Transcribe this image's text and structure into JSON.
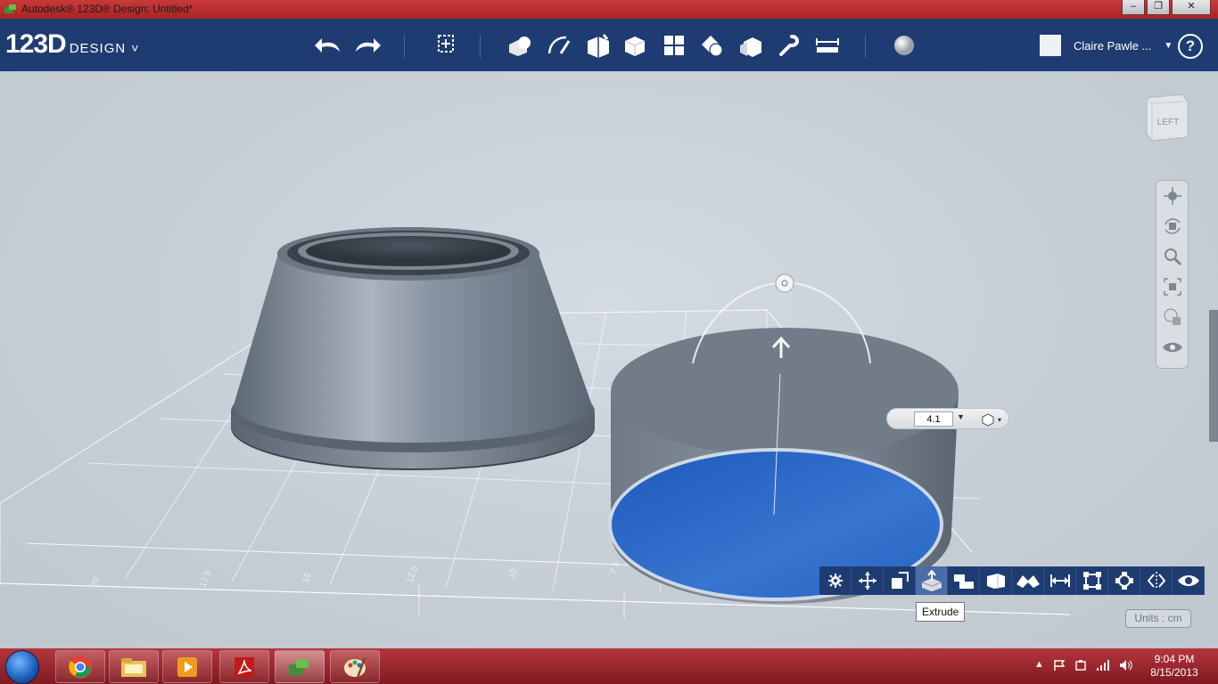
{
  "window": {
    "title": "Autodesk® 123D® Design: Untitled*",
    "minimize": "‒",
    "restore": "❐",
    "close": "✕"
  },
  "app": {
    "logo_main": "123D",
    "logo_sub": "DESIGN",
    "logo_chevron": "˅"
  },
  "toolbar": {
    "icons": [
      "undo-icon",
      "redo-icon",
      "transform-icon",
      "primitives-icon",
      "sketch-icon",
      "construct-icon",
      "modify-icon",
      "pattern-icon",
      "grouping-icon",
      "combine-icon",
      "snap-icon",
      "measure-icon",
      "material-icon"
    ]
  },
  "user": {
    "name": "Claire Pawle ...",
    "caret": "▼"
  },
  "help": {
    "label": "?"
  },
  "viewcube": {
    "face": "LEFT"
  },
  "navbar": {
    "icons": [
      "pan-icon",
      "orbit-icon",
      "zoom-icon",
      "fit-icon",
      "view-style-icon",
      "visibility-icon"
    ]
  },
  "extrude": {
    "value": "4.1",
    "dropdown": "▼",
    "snap_caret": "▾"
  },
  "context_toolbar": {
    "icons": [
      "settings-icon",
      "move-icon",
      "scale-icon",
      "extrude-icon",
      "sweep-icon",
      "revolve-icon",
      "loft-icon",
      "measure-icon",
      "bounding-box-icon",
      "align-icon",
      "mirror-icon",
      "eye-icon"
    ],
    "active": "extrude-icon",
    "tooltip": "Extrude"
  },
  "units": {
    "label": "Units : cm"
  },
  "grid_labels": [
    "20",
    "17.5",
    "15",
    "12.5",
    "10",
    "7.5"
  ],
  "taskbar": {
    "apps": [
      "chrome-icon",
      "explorer-icon",
      "media-player-icon",
      "acrobat-icon",
      "123d-icon",
      "paint-icon"
    ],
    "time": "9:04 PM",
    "date": "8/15/2013",
    "tray_caret": "▲"
  }
}
